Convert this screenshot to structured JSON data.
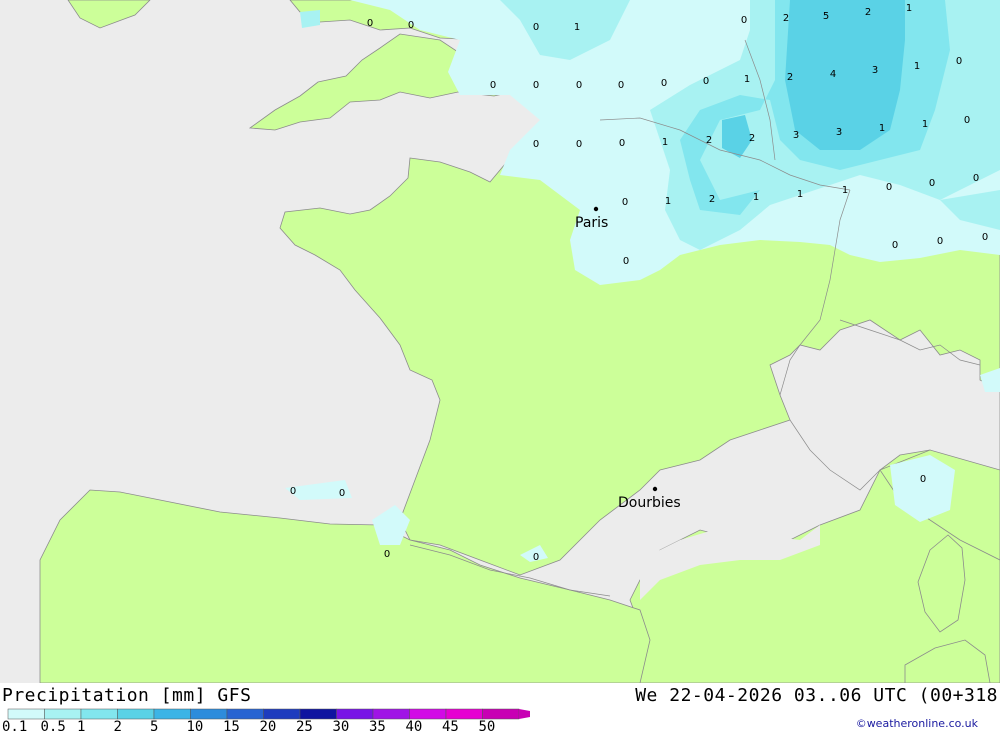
{
  "legend": {
    "title": "Precipitation [mm] GFS",
    "steps": [
      {
        "label": "0.1",
        "color": "#d2fafa"
      },
      {
        "label": "0.5",
        "color": "#a8f2f2"
      },
      {
        "label": "1",
        "color": "#82e6ee"
      },
      {
        "label": "2",
        "color": "#5ad2e6"
      },
      {
        "label": "5",
        "color": "#3cb4e6"
      },
      {
        "label": "10",
        "color": "#2d8cdc"
      },
      {
        "label": "15",
        "color": "#2864d2"
      },
      {
        "label": "20",
        "color": "#1e3cbe"
      },
      {
        "label": "25",
        "color": "#0f14a0"
      },
      {
        "label": "30",
        "color": "#7814e6"
      },
      {
        "label": "35",
        "color": "#a014e6"
      },
      {
        "label": "40",
        "color": "#d20ae6"
      },
      {
        "label": "45",
        "color": "#e600d2"
      },
      {
        "label": "50",
        "color": "#c800b4"
      }
    ]
  },
  "valid_time": "We 22-04-2026 03..06 UTC (00+318",
  "credit": "©weatheronline.co.uk",
  "colors": {
    "sea": "#ececec",
    "land": "#ccff99",
    "precip_light": "#d2fafa",
    "precip_low": "#a8f2f2",
    "precip_mid": "#82e6ee",
    "precip_high": "#5ad2e6",
    "border": "#8c8c8c"
  },
  "cities": [
    {
      "name": "Paris"
    },
    {
      "name": "Dourbies"
    }
  ],
  "values": [
    "0",
    "0",
    "0",
    "1",
    "0",
    "2",
    "5",
    "2",
    "1",
    "0",
    "0",
    "0",
    "0",
    "0",
    "0",
    "1",
    "2",
    "4",
    "3",
    "1",
    "0",
    "0",
    "0",
    "0",
    "1",
    "2",
    "2",
    "3",
    "3",
    "1",
    "1",
    "0",
    "1",
    "2",
    "1",
    "1",
    "1",
    "0",
    "0",
    "0",
    "0",
    "0",
    "0",
    "0",
    "0",
    "0",
    "0",
    "0",
    "0"
  ]
}
